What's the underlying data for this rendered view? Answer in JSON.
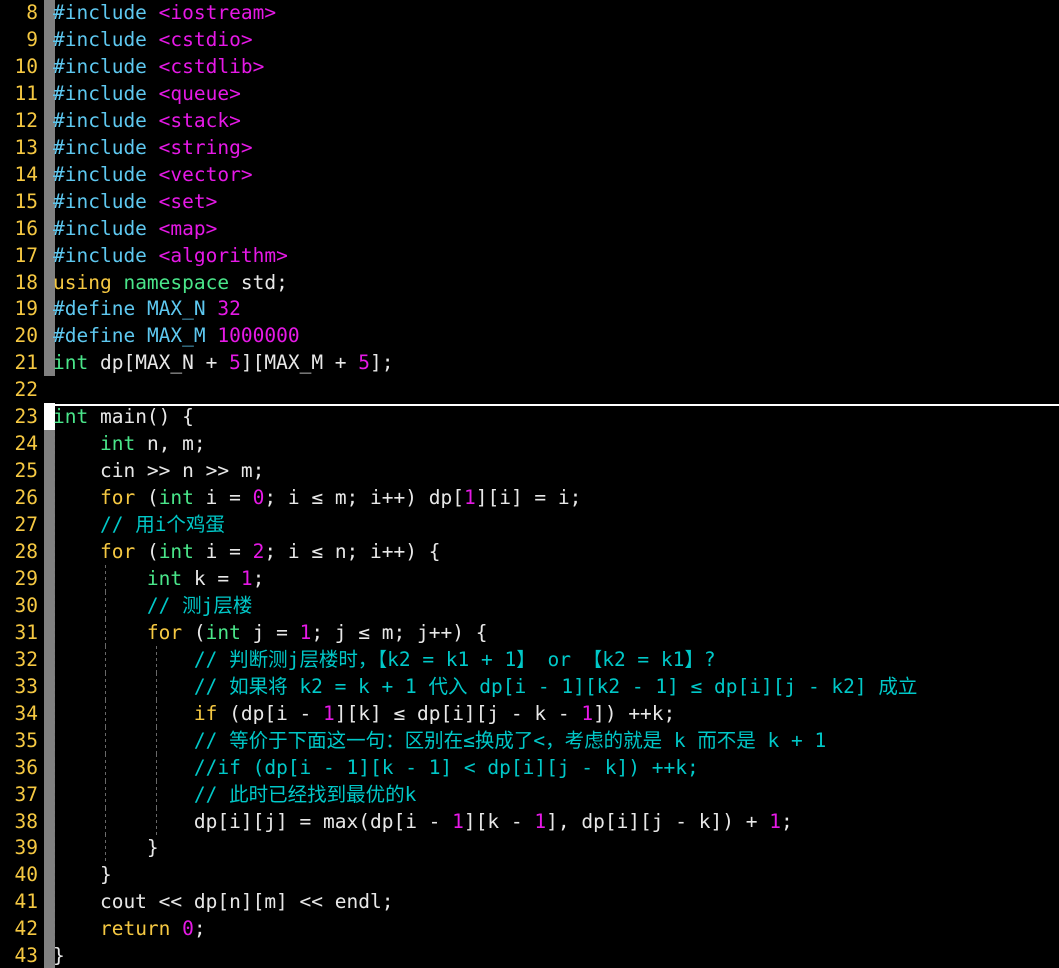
{
  "editor": {
    "language": "C++",
    "theme": "dark-high-contrast",
    "background_color": "#000000",
    "first_visible_line": 8,
    "last_visible_line": 43,
    "colors": {
      "line_number": "#f5c842",
      "preprocessor": "#5ec8f0",
      "include_path": "#e619e6",
      "number_literal": "#e619e6",
      "type": "#4ae68a",
      "keyword": "#f5c842",
      "identifier": "#e8e8e8",
      "comment": "#00c8c8",
      "gutter_modified": "#808080",
      "gutter_added": "#ffffff",
      "indent_guide": "#7a7a7a",
      "section_divider": "#ffffff"
    }
  },
  "lines": [
    {
      "n": "8",
      "gutter": "modified",
      "indent": 0,
      "text": "#include <iostream>",
      "tokens": [
        {
          "c": "t-pre",
          "s": "#include"
        },
        {
          "c": "t-id",
          "s": " "
        },
        {
          "c": "t-inc",
          "s": "<iostream>"
        }
      ]
    },
    {
      "n": "9",
      "gutter": "modified",
      "indent": 0,
      "text": "#include <cstdio>",
      "tokens": [
        {
          "c": "t-pre",
          "s": "#include"
        },
        {
          "c": "t-id",
          "s": " "
        },
        {
          "c": "t-inc",
          "s": "<cstdio>"
        }
      ]
    },
    {
      "n": "10",
      "gutter": "modified",
      "indent": 0,
      "text": "#include <cstdlib>",
      "tokens": [
        {
          "c": "t-pre",
          "s": "#include"
        },
        {
          "c": "t-id",
          "s": " "
        },
        {
          "c": "t-inc",
          "s": "<cstdlib>"
        }
      ]
    },
    {
      "n": "11",
      "gutter": "modified",
      "indent": 0,
      "text": "#include <queue>",
      "tokens": [
        {
          "c": "t-pre",
          "s": "#include"
        },
        {
          "c": "t-id",
          "s": " "
        },
        {
          "c": "t-inc",
          "s": "<queue>"
        }
      ]
    },
    {
      "n": "12",
      "gutter": "modified",
      "indent": 0,
      "text": "#include <stack>",
      "tokens": [
        {
          "c": "t-pre",
          "s": "#include"
        },
        {
          "c": "t-id",
          "s": " "
        },
        {
          "c": "t-inc",
          "s": "<stack>"
        }
      ]
    },
    {
      "n": "13",
      "gutter": "modified",
      "indent": 0,
      "text": "#include <string>",
      "tokens": [
        {
          "c": "t-pre",
          "s": "#include"
        },
        {
          "c": "t-id",
          "s": " "
        },
        {
          "c": "t-inc",
          "s": "<string>"
        }
      ]
    },
    {
      "n": "14",
      "gutter": "modified",
      "indent": 0,
      "text": "#include <vector>",
      "tokens": [
        {
          "c": "t-pre",
          "s": "#include"
        },
        {
          "c": "t-id",
          "s": " "
        },
        {
          "c": "t-inc",
          "s": "<vector>"
        }
      ]
    },
    {
      "n": "15",
      "gutter": "modified",
      "indent": 0,
      "text": "#include <set>",
      "tokens": [
        {
          "c": "t-pre",
          "s": "#include"
        },
        {
          "c": "t-id",
          "s": " "
        },
        {
          "c": "t-inc",
          "s": "<set>"
        }
      ]
    },
    {
      "n": "16",
      "gutter": "modified",
      "indent": 0,
      "text": "#include <map>",
      "tokens": [
        {
          "c": "t-pre",
          "s": "#include"
        },
        {
          "c": "t-id",
          "s": " "
        },
        {
          "c": "t-inc",
          "s": "<map>"
        }
      ]
    },
    {
      "n": "17",
      "gutter": "modified",
      "indent": 0,
      "text": "#include <algorithm>",
      "tokens": [
        {
          "c": "t-pre",
          "s": "#include"
        },
        {
          "c": "t-id",
          "s": " "
        },
        {
          "c": "t-inc",
          "s": "<algorithm>"
        }
      ]
    },
    {
      "n": "18",
      "gutter": "modified",
      "indent": 0,
      "text": "using namespace std;",
      "tokens": [
        {
          "c": "t-kw",
          "s": "using"
        },
        {
          "c": "t-id",
          "s": " "
        },
        {
          "c": "t-type",
          "s": "namespace"
        },
        {
          "c": "t-id",
          "s": " std;"
        }
      ]
    },
    {
      "n": "19",
      "gutter": "modified",
      "indent": 0,
      "text": "#define MAX_N 32",
      "tokens": [
        {
          "c": "t-pre",
          "s": "#define"
        },
        {
          "c": "t-id",
          "s": " "
        },
        {
          "c": "t-macro",
          "s": "MAX_N"
        },
        {
          "c": "t-id",
          "s": " "
        },
        {
          "c": "t-num",
          "s": "32"
        }
      ]
    },
    {
      "n": "20",
      "gutter": "modified",
      "indent": 0,
      "text": "#define MAX_M 1000000",
      "tokens": [
        {
          "c": "t-pre",
          "s": "#define"
        },
        {
          "c": "t-id",
          "s": " "
        },
        {
          "c": "t-macro",
          "s": "MAX_M"
        },
        {
          "c": "t-id",
          "s": " "
        },
        {
          "c": "t-num",
          "s": "1000000"
        }
      ]
    },
    {
      "n": "21",
      "gutter": "modified",
      "indent": 0,
      "text": "int dp[MAX_N + 5][MAX_M + 5];",
      "tokens": [
        {
          "c": "t-type",
          "s": "int"
        },
        {
          "c": "t-id",
          "s": " dp[MAX_N + "
        },
        {
          "c": "t-num",
          "s": "5"
        },
        {
          "c": "t-id",
          "s": "][MAX_M + "
        },
        {
          "c": "t-num",
          "s": "5"
        },
        {
          "c": "t-id",
          "s": "];"
        }
      ]
    },
    {
      "n": "22",
      "gutter": "none",
      "indent": 0,
      "text": "",
      "tokens": []
    },
    {
      "n": "23",
      "gutter": "added",
      "indent": 0,
      "text": "int main() {",
      "tokens": [
        {
          "c": "t-type",
          "s": "int"
        },
        {
          "c": "t-id",
          "s": " main() {"
        }
      ]
    },
    {
      "n": "24",
      "gutter": "modified",
      "indent": 1,
      "text": "    int n, m;",
      "tokens": [
        {
          "c": "t-id",
          "s": "    "
        },
        {
          "c": "t-type",
          "s": "int"
        },
        {
          "c": "t-id",
          "s": " n, m;"
        }
      ]
    },
    {
      "n": "25",
      "gutter": "modified",
      "indent": 1,
      "text": "    cin >> n >> m;",
      "tokens": [
        {
          "c": "t-id",
          "s": "    cin >> n >> m;"
        }
      ]
    },
    {
      "n": "26",
      "gutter": "modified",
      "indent": 1,
      "text": "    for (int i = 0; i ≤ m; i++) dp[1][i] = i;",
      "tokens": [
        {
          "c": "t-id",
          "s": "    "
        },
        {
          "c": "t-kw",
          "s": "for"
        },
        {
          "c": "t-id",
          "s": " ("
        },
        {
          "c": "t-type",
          "s": "int"
        },
        {
          "c": "t-id",
          "s": " i = "
        },
        {
          "c": "t-num",
          "s": "0"
        },
        {
          "c": "t-id",
          "s": "; i ≤ m; i++) dp["
        },
        {
          "c": "t-num",
          "s": "1"
        },
        {
          "c": "t-id",
          "s": "][i] = i;"
        }
      ]
    },
    {
      "n": "27",
      "gutter": "modified",
      "indent": 1,
      "text": "    // 用i个鸡蛋",
      "tokens": [
        {
          "c": "t-id",
          "s": "    "
        },
        {
          "c": "t-cmt",
          "s": "// 用i个鸡蛋"
        }
      ]
    },
    {
      "n": "28",
      "gutter": "modified",
      "indent": 1,
      "text": "    for (int i = 2; i ≤ n; i++) {",
      "tokens": [
        {
          "c": "t-id",
          "s": "    "
        },
        {
          "c": "t-kw",
          "s": "for"
        },
        {
          "c": "t-id",
          "s": " ("
        },
        {
          "c": "t-type",
          "s": "int"
        },
        {
          "c": "t-id",
          "s": " i = "
        },
        {
          "c": "t-num",
          "s": "2"
        },
        {
          "c": "t-id",
          "s": "; i ≤ n; i++) {"
        }
      ]
    },
    {
      "n": "29",
      "gutter": "modified",
      "indent": 2,
      "text": "        int k = 1;",
      "tokens": [
        {
          "c": "t-id",
          "s": "        "
        },
        {
          "c": "t-type",
          "s": "int"
        },
        {
          "c": "t-id",
          "s": " k = "
        },
        {
          "c": "t-num",
          "s": "1"
        },
        {
          "c": "t-id",
          "s": ";"
        }
      ]
    },
    {
      "n": "30",
      "gutter": "modified",
      "indent": 2,
      "text": "        // 测j层楼",
      "tokens": [
        {
          "c": "t-id",
          "s": "        "
        },
        {
          "c": "t-cmt",
          "s": "// 测j层楼"
        }
      ]
    },
    {
      "n": "31",
      "gutter": "modified",
      "indent": 2,
      "text": "        for (int j = 1; j ≤ m; j++) {",
      "tokens": [
        {
          "c": "t-id",
          "s": "        "
        },
        {
          "c": "t-kw",
          "s": "for"
        },
        {
          "c": "t-id",
          "s": " ("
        },
        {
          "c": "t-type",
          "s": "int"
        },
        {
          "c": "t-id",
          "s": " j = "
        },
        {
          "c": "t-num",
          "s": "1"
        },
        {
          "c": "t-id",
          "s": "; j ≤ m; j++) {"
        }
      ]
    },
    {
      "n": "32",
      "gutter": "modified",
      "indent": 3,
      "text": "            // 判断测j层楼时，【k2 = k1 + 1】 or 【k2 = k1】?",
      "tokens": [
        {
          "c": "t-id",
          "s": "            "
        },
        {
          "c": "t-cmt",
          "s": "// 判断测j层楼时，【k2 = k1 + 1】 or 【k2 = k1】?"
        }
      ]
    },
    {
      "n": "33",
      "gutter": "modified",
      "indent": 3,
      "text": "            // 如果将 k2 = k + 1 代入 dp[i - 1][k2 - 1] ≤ dp[i][j - k2] 成立",
      "tokens": [
        {
          "c": "t-id",
          "s": "            "
        },
        {
          "c": "t-cmt",
          "s": "// 如果将 k2 = k + 1 代入 dp[i - 1][k2 - 1] ≤ dp[i][j - k2] 成立"
        }
      ]
    },
    {
      "n": "34",
      "gutter": "modified",
      "indent": 3,
      "text": "            if (dp[i - 1][k] ≤ dp[i][j - k - 1]) ++k;",
      "tokens": [
        {
          "c": "t-id",
          "s": "            "
        },
        {
          "c": "t-kw",
          "s": "if"
        },
        {
          "c": "t-id",
          "s": " (dp[i - "
        },
        {
          "c": "t-num",
          "s": "1"
        },
        {
          "c": "t-id",
          "s": "][k] ≤ dp[i][j - k - "
        },
        {
          "c": "t-num",
          "s": "1"
        },
        {
          "c": "t-id",
          "s": "]) ++k;"
        }
      ]
    },
    {
      "n": "35",
      "gutter": "modified",
      "indent": 3,
      "text": "            // 等价于下面这一句：区别在≤换成了<，考虑的就是 k 而不是 k + 1",
      "tokens": [
        {
          "c": "t-id",
          "s": "            "
        },
        {
          "c": "t-cmt",
          "s": "// 等价于下面这一句：区别在≤换成了<，考虑的就是 k 而不是 k + 1"
        }
      ]
    },
    {
      "n": "36",
      "gutter": "modified",
      "indent": 3,
      "text": "            //if (dp[i - 1][k - 1] < dp[i][j - k]) ++k;",
      "tokens": [
        {
          "c": "t-id",
          "s": "            "
        },
        {
          "c": "t-cmt",
          "s": "//if (dp[i - 1][k - 1] < dp[i][j - k]) ++k;"
        }
      ]
    },
    {
      "n": "37",
      "gutter": "modified",
      "indent": 3,
      "text": "            // 此时已经找到最优的k",
      "tokens": [
        {
          "c": "t-id",
          "s": "            "
        },
        {
          "c": "t-cmt",
          "s": "// 此时已经找到最优的k"
        }
      ]
    },
    {
      "n": "38",
      "gutter": "modified",
      "indent": 3,
      "text": "            dp[i][j] = max(dp[i - 1][k - 1], dp[i][j - k]) + 1;",
      "tokens": [
        {
          "c": "t-id",
          "s": "            dp[i][j] = max(dp[i - "
        },
        {
          "c": "t-num",
          "s": "1"
        },
        {
          "c": "t-id",
          "s": "][k - "
        },
        {
          "c": "t-num",
          "s": "1"
        },
        {
          "c": "t-id",
          "s": "], dp[i][j - k]) + "
        },
        {
          "c": "t-num",
          "s": "1"
        },
        {
          "c": "t-id",
          "s": ";"
        }
      ]
    },
    {
      "n": "39",
      "gutter": "modified",
      "indent": 2,
      "text": "        }",
      "tokens": [
        {
          "c": "t-id",
          "s": "        }"
        }
      ]
    },
    {
      "n": "40",
      "gutter": "modified",
      "indent": 1,
      "text": "    }",
      "tokens": [
        {
          "c": "t-id",
          "s": "    }"
        }
      ]
    },
    {
      "n": "41",
      "gutter": "modified",
      "indent": 1,
      "text": "    cout << dp[n][m] << endl;",
      "tokens": [
        {
          "c": "t-id",
          "s": "    cout << dp[n][m] << endl;"
        }
      ]
    },
    {
      "n": "42",
      "gutter": "modified",
      "indent": 1,
      "text": "    return 0;",
      "tokens": [
        {
          "c": "t-id",
          "s": "    "
        },
        {
          "c": "t-kw",
          "s": "return"
        },
        {
          "c": "t-id",
          "s": " "
        },
        {
          "c": "t-num",
          "s": "0"
        },
        {
          "c": "t-id",
          "s": ";"
        }
      ]
    },
    {
      "n": "43",
      "gutter": "modified",
      "indent": 0,
      "text": "}",
      "tokens": [
        {
          "c": "t-id",
          "s": "}"
        }
      ]
    }
  ],
  "section_divider": {
    "after_line": "22",
    "description": "white horizontal separator spanning editor width"
  }
}
